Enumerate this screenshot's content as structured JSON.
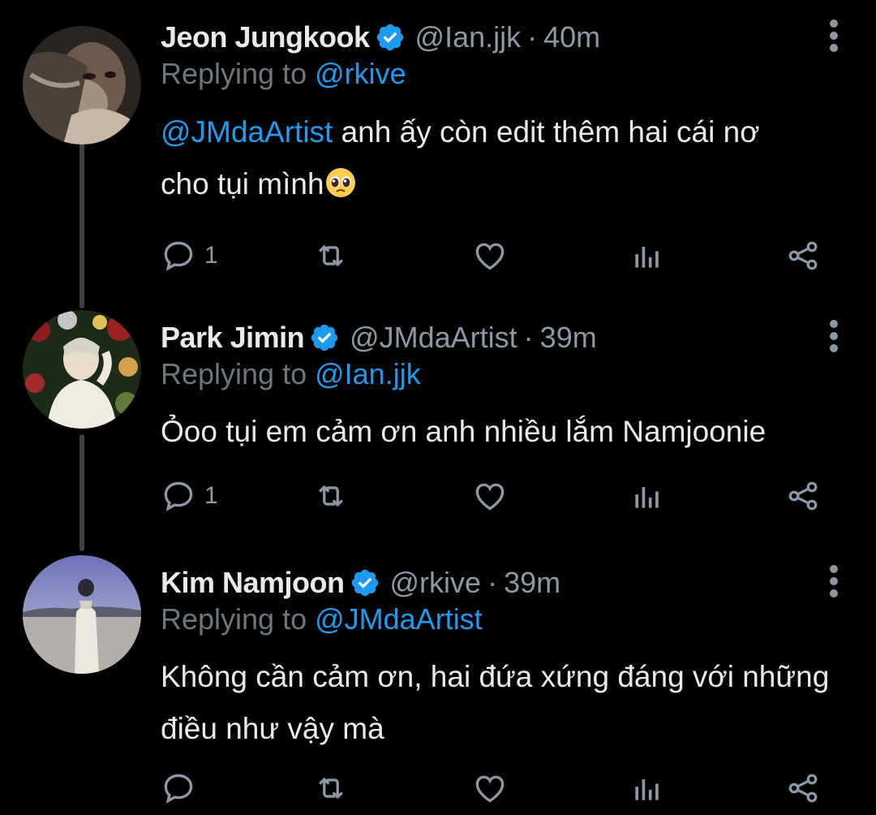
{
  "tweets": [
    {
      "name": "Jeon Jungkook",
      "handle": "@Ian.jjk",
      "time": "40m",
      "replying_prefix": "Replying to ",
      "replying_to": "@rkive",
      "mention": "@JMdaArtist",
      "text_line1": " anh ấy còn edit thêm hai cái nơ",
      "text_line2": "cho tụi mình",
      "emoji": "pleading-face-emoji",
      "reply_count": "1"
    },
    {
      "name": "Park Jimin",
      "handle": "@JMdaArtist",
      "time": "39m",
      "replying_prefix": "Replying to ",
      "replying_to": "@Ian.jjk",
      "text_line1": "Ỏoo tụi em cảm ơn anh nhiều lắm Namjoonie",
      "reply_count": "1"
    },
    {
      "name": "Kim Namjoon",
      "handle": "@rkive",
      "time": "39m",
      "replying_prefix": "Replying to ",
      "replying_to": "@JMdaArtist",
      "text_line1": "Không cần cảm ơn, hai đứa xứng đáng với những",
      "text_line2": "điều như vậy mà",
      "reply_count": ""
    }
  ],
  "separator": "·",
  "colors": {
    "background": "#000000",
    "accent": "#1d9bf0",
    "muted": "#8b98a5",
    "text": "#e7e9ea",
    "thread_line": "#3d4146"
  },
  "icons": [
    "verified-badge-icon",
    "more-vertical-icon",
    "reply-icon",
    "retweet-icon",
    "like-icon",
    "analytics-icon",
    "share-icon"
  ]
}
